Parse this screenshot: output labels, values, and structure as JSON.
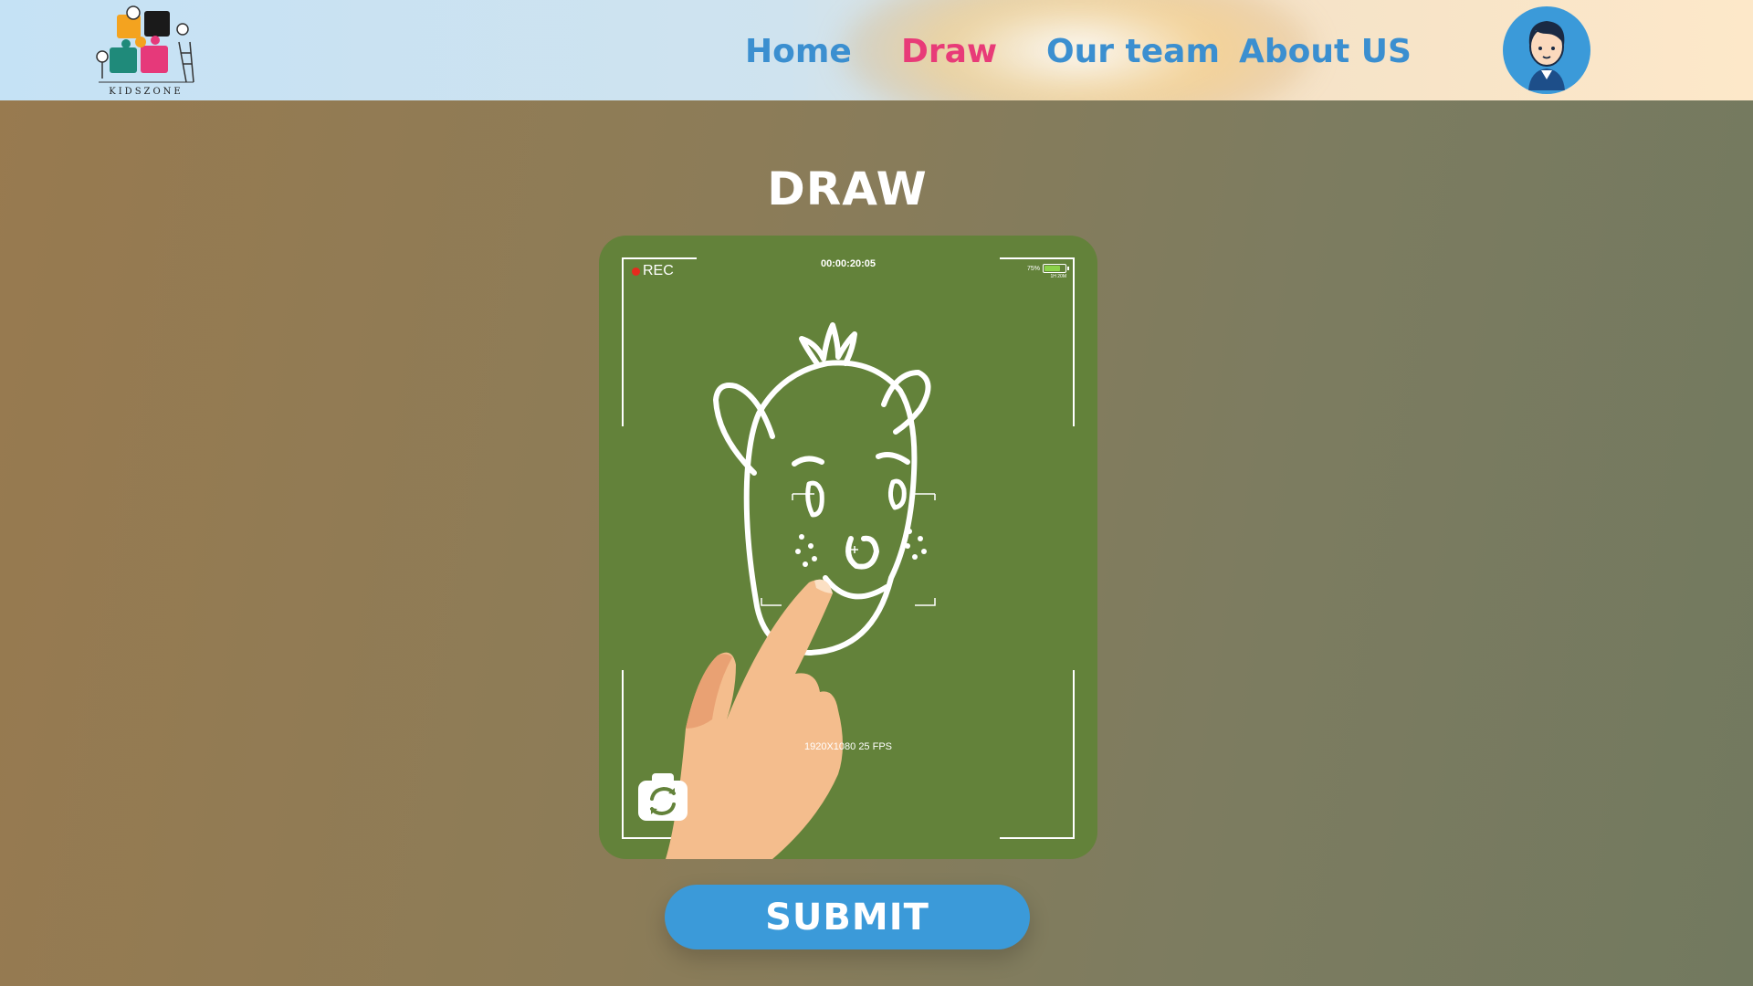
{
  "brand": {
    "logo_text": "KIDSZONE",
    "logo_icon": "puzzle-kids-logo"
  },
  "nav": {
    "links": [
      {
        "label": "Home",
        "active": false
      },
      {
        "label": "Draw",
        "active": true
      },
      {
        "label": "Our team",
        "active": false
      },
      {
        "label": "About US",
        "active": false
      }
    ],
    "avatar_icon": "user-avatar-icon"
  },
  "page": {
    "title": "DRAW"
  },
  "camera": {
    "rec_label": "REC",
    "timecode": "00:00:20:05",
    "battery_percent": "75%",
    "battery_sub": "1H 20M",
    "resolution": "1920X1080 25 FPS",
    "switch_icon": "camera-switch-icon",
    "drawing_icon": "face-drawing-icon"
  },
  "actions": {
    "submit_label": "SUBMIT"
  },
  "colors": {
    "accent": "#3b9ad9",
    "active_link": "#e83b78",
    "canvas": "#63823a"
  }
}
